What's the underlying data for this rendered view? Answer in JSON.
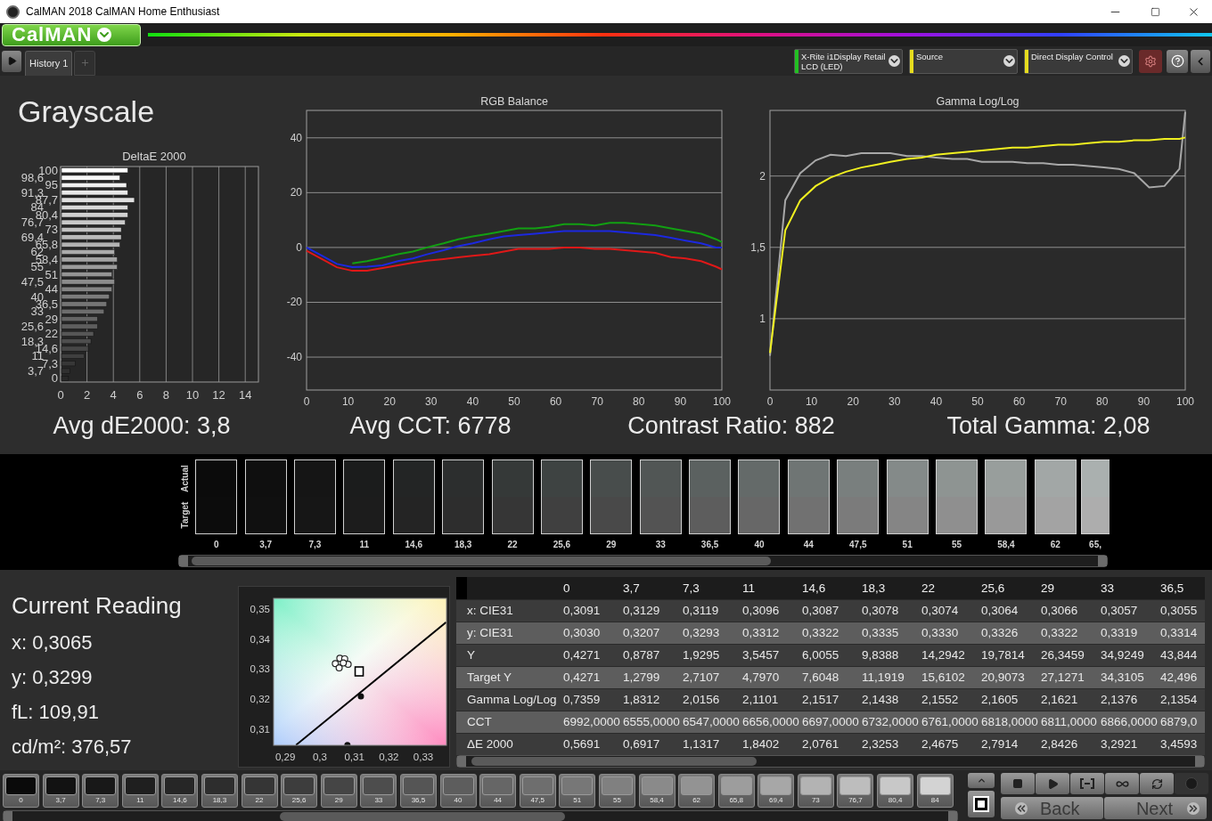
{
  "window": {
    "title": "CalMAN 2018 CalMAN Home Enthusiast"
  },
  "toolbar": {
    "logo": "CalMAN"
  },
  "tabs": [
    {
      "label": "History 1",
      "selected": true
    }
  ],
  "devices": [
    {
      "label": "X-Rite i1Display Retail",
      "sublabel": "LCD (LED)",
      "color": "#22c022"
    },
    {
      "label": "Source",
      "color": "#e6dc1e"
    },
    {
      "label": "Direct Display Control",
      "color": "#e6dc1e"
    }
  ],
  "page": {
    "title": "Grayscale",
    "delta_chart": {
      "chart_data": {
        "type": "bar",
        "orientation": "horizontal",
        "title": "DeltaE 2000",
        "grid": true,
        "categories": [
          "100",
          "98,6",
          "95",
          "91,3",
          "87,7",
          "84",
          "80,4",
          "76,7",
          "73",
          "69,4",
          "65,8",
          "62",
          "58,4",
          "55",
          "51",
          "47,5",
          "44",
          "40",
          "36,5",
          "33",
          "29",
          "25,6",
          "22",
          "18,3",
          "14,6",
          "11",
          "7,3",
          "3,7",
          "0"
        ],
        "values": [
          5.1,
          4.5,
          5.0,
          5.1,
          5.6,
          5.1,
          5.1,
          4.9,
          4.6,
          4.6,
          4.5,
          4.1,
          4.3,
          4.3,
          3.9,
          4.1,
          3.9,
          3.7,
          3.5,
          3.3,
          2.8,
          2.8,
          2.5,
          2.3,
          2.1,
          1.8,
          1.1,
          0.7,
          0.6
        ],
        "xlim": [
          0,
          15
        ],
        "xticks": [
          0,
          2,
          4,
          6,
          8,
          10,
          12,
          14
        ]
      }
    },
    "rgb_chart": {
      "chart_data": {
        "type": "line",
        "title": "RGB Balance",
        "grid": true,
        "x": [
          0,
          3.7,
          7.3,
          11,
          14.6,
          18.3,
          22,
          25.6,
          29,
          33,
          36.5,
          40,
          44,
          47.5,
          51,
          55,
          58.4,
          62,
          65.8,
          69.4,
          73,
          76.7,
          80.4,
          84,
          87.7,
          91.3,
          95,
          98.6,
          100
        ],
        "series": [
          {
            "color": "#e01818",
            "values": [
              -1.2,
              -4.2,
              -7.2,
              -8.5,
              -8.5,
              -7.5,
              -6.5,
              -5.5,
              -4.8,
              -4.2,
              -3.6,
              -3,
              -2.5,
              -1.5,
              -0.5,
              -0.5,
              -0.5,
              0,
              0,
              -0.5,
              -0.5,
              -1,
              -1.5,
              -2,
              -3.5,
              -4,
              -5,
              -7,
              -8
            ]
          },
          {
            "color": "#12a012",
            "values": [
              null,
              null,
              null,
              -5.8,
              -5,
              -3.8,
              -2.5,
              -1.5,
              0,
              1.5,
              3,
              4,
              5,
              6,
              7,
              7,
              7.5,
              8.5,
              8.5,
              8,
              9,
              9,
              8.5,
              8,
              7,
              6,
              5,
              3,
              2
            ]
          },
          {
            "color": "#1c28e0",
            "values": [
              0,
              -3,
              -6,
              -7.2,
              -7,
              -6.5,
              -5,
              -4,
              -2.5,
              -1,
              0.5,
              1.5,
              3,
              4,
              4.5,
              5,
              5.5,
              6,
              6,
              6,
              6,
              5.5,
              5,
              4.5,
              3.5,
              2.5,
              1.5,
              0,
              0
            ]
          }
        ],
        "xlim": [
          0,
          100
        ],
        "ylim": [
          -52,
          50
        ],
        "xticks": [
          0,
          10,
          20,
          30,
          40,
          50,
          60,
          70,
          80,
          90,
          100
        ],
        "yticks": [
          -40,
          -20,
          0,
          20,
          40
        ]
      }
    },
    "gamma_chart": {
      "chart_data": {
        "type": "line",
        "title": "Gamma Log/Log",
        "grid": true,
        "x": [
          0,
          3.7,
          7.3,
          11,
          14.6,
          18.3,
          22,
          25.6,
          29,
          33,
          36.5,
          40,
          44,
          47.5,
          51,
          55,
          58.4,
          62,
          65.8,
          69.4,
          73,
          76.7,
          80.4,
          84,
          87.7,
          91.3,
          95,
          98.6,
          100
        ],
        "series": [
          {
            "color": "#a8a8a8",
            "values": [
              0.74,
              1.83,
              2.02,
              2.11,
              2.15,
              2.14,
              2.16,
              2.16,
              2.16,
              2.14,
              2.14,
              2.13,
              2.12,
              2.12,
              2.1,
              2.1,
              2.1,
              2.09,
              2.09,
              2.08,
              2.08,
              2.07,
              2.06,
              2.05,
              2.02,
              1.92,
              1.93,
              2.05,
              2.45
            ]
          },
          {
            "color": "#f0f020",
            "values": [
              0.76,
              1.62,
              1.83,
              1.93,
              1.99,
              2.03,
              2.06,
              2.08,
              2.1,
              2.12,
              2.13,
              2.15,
              2.16,
              2.17,
              2.18,
              2.19,
              2.2,
              2.2,
              2.21,
              2.22,
              2.22,
              2.23,
              2.24,
              2.24,
              2.25,
              2.25,
              2.26,
              2.26,
              2.27
            ]
          }
        ],
        "xlim": [
          0,
          100
        ],
        "ylim": [
          0.5,
          2.46
        ],
        "xticks": [
          0,
          10,
          20,
          30,
          40,
          50,
          60,
          70,
          80,
          90,
          100
        ],
        "yticks": [
          {
            "value": 1,
            "label": "1"
          },
          {
            "value": 1.5,
            "label": "1,5"
          },
          {
            "value": 2,
            "label": "2"
          }
        ]
      }
    },
    "stats": [
      "Avg dE2000: 3,8",
      "Avg CCT: 6778",
      "Contrast Ratio: 882",
      "Total Gamma: 2,08"
    ]
  },
  "swatches": {
    "actual_label": "Actual",
    "target_label": "Target",
    "items": [
      {
        "label": "0",
        "actual": {
          "color": "#0b0b0b"
        },
        "target": {
          "color": "#0c0c0c"
        }
      },
      {
        "label": "3,7",
        "actual": {
          "color": "#0f0f0f"
        },
        "target": {
          "color": "#101010"
        }
      },
      {
        "label": "7,3",
        "actual": {
          "color": "#151515"
        },
        "target": {
          "color": "#161616"
        }
      },
      {
        "label": "11",
        "actual": {
          "color": "#1b1c1c"
        },
        "target": {
          "color": "#1c1c1c"
        }
      },
      {
        "label": "14,6",
        "actual": {
          "color": "#232525"
        },
        "target": {
          "color": "#242424"
        }
      },
      {
        "label": "18,3",
        "actual": {
          "color": "#2c2e2e"
        },
        "target": {
          "color": "#2d2d2d"
        }
      },
      {
        "label": "22",
        "actual": {
          "color": "#353938"
        },
        "target": {
          "color": "#363636"
        }
      },
      {
        "label": "25,6",
        "actual": {
          "color": "#3e4342"
        },
        "target": {
          "color": "#404040"
        }
      },
      {
        "label": "29",
        "actual": {
          "color": "#484d4c"
        },
        "target": {
          "color": "#494949"
        }
      },
      {
        "label": "33",
        "actual": {
          "color": "#515655"
        },
        "target": {
          "color": "#535353"
        }
      },
      {
        "label": "36,5",
        "actual": {
          "color": "#5b6160"
        },
        "target": {
          "color": "#5d5d5d"
        }
      },
      {
        "label": "40",
        "actual": {
          "color": "#646a69"
        },
        "target": {
          "color": "#676767"
        }
      },
      {
        "label": "44",
        "actual": {
          "color": "#6f7574"
        },
        "target": {
          "color": "#717171"
        }
      },
      {
        "label": "47,5",
        "actual": {
          "color": "#797f7e"
        },
        "target": {
          "color": "#7b7b7b"
        }
      },
      {
        "label": "51",
        "actual": {
          "color": "#848a89"
        },
        "target": {
          "color": "#858585"
        }
      },
      {
        "label": "55",
        "actual": {
          "color": "#8e9492"
        },
        "target": {
          "color": "#8f8f8f"
        }
      },
      {
        "label": "58,4",
        "actual": {
          "color": "#989e9c"
        },
        "target": {
          "color": "#999999"
        }
      },
      {
        "label": "62",
        "actual": {
          "color": "#a2a7a6"
        },
        "target": {
          "color": "#a3a3a3"
        }
      },
      {
        "label": "65,",
        "actual": {
          "color": "#aab0af"
        },
        "target": {
          "color": "#adadad"
        }
      }
    ]
  },
  "current_reading": {
    "title": "Current Reading",
    "values": [
      "x: 0,3065",
      "y: 0,3299",
      "fL: 109,91",
      "cd/m²: 376,57"
    ]
  },
  "chromaticity": {
    "chart_data": {
      "type": "scatter",
      "x": [
        0.3045,
        0.3058,
        0.3072,
        0.3082,
        0.3056,
        0.3068,
        0.3114,
        0.3119,
        0.308,
        0.2931,
        0.3366
      ],
      "series": [
        {
          "type": "scatter",
          "color": "#ffffff",
          "values": [
            0.3318,
            0.3336,
            0.3334,
            0.3316,
            0.3304,
            0.332,
            null,
            null,
            null,
            null,
            null
          ]
        },
        {
          "type": "scatter",
          "color": "#000000",
          "values": [
            null,
            null,
            null,
            null,
            null,
            null,
            0.3292,
            null,
            null,
            null,
            null
          ]
        },
        {
          "type": "scatter",
          "color": "#111111",
          "values": [
            null,
            null,
            null,
            null,
            null,
            null,
            null,
            0.3209,
            0.3046,
            null,
            null
          ]
        },
        {
          "type": "line",
          "color": "#000000",
          "values": [
            null,
            null,
            null,
            null,
            null,
            null,
            null,
            null,
            null,
            0.3046,
            0.3456
          ]
        }
      ],
      "xlim": [
        0.2866,
        0.3367
      ],
      "ylim": [
        0.3045,
        0.3536
      ],
      "xticks": [
        {
          "value": 0.29,
          "label": "0,29"
        },
        {
          "value": 0.3,
          "label": "0,3"
        },
        {
          "value": 0.31,
          "label": "0,31"
        },
        {
          "value": 0.32,
          "label": "0,32"
        },
        {
          "value": 0.33,
          "label": "0,33"
        }
      ],
      "yticks": [
        {
          "value": 0.31,
          "label": "0,31"
        },
        {
          "value": 0.32,
          "label": "0,32"
        },
        {
          "value": 0.33,
          "label": "0,33"
        },
        {
          "value": 0.34,
          "label": "0,34"
        },
        {
          "value": 0.35,
          "label": "0,35"
        }
      ]
    }
  },
  "table": {
    "columns": [
      "0",
      "3,7",
      "7,3",
      "11",
      "14,6",
      "18,3",
      "22",
      "25,6",
      "29",
      "33",
      "36,5"
    ],
    "rows": [
      {
        "label": "x: CIE31",
        "cells": [
          "0,3091",
          "0,3129",
          "0,3119",
          "0,3096",
          "0,3087",
          "0,3078",
          "0,3074",
          "0,3064",
          "0,3066",
          "0,3057",
          "0,3055"
        ]
      },
      {
        "label": "y: CIE31",
        "cells": [
          "0,3030",
          "0,3207",
          "0,3293",
          "0,3312",
          "0,3322",
          "0,3335",
          "0,3330",
          "0,3326",
          "0,3322",
          "0,3319",
          "0,3314"
        ]
      },
      {
        "label": "Y",
        "cells": [
          "0,4271",
          "0,8787",
          "1,9295",
          "3,5457",
          "6,0055",
          "9,8388",
          "14,2942",
          "19,7814",
          "26,3459",
          "34,9249",
          "43,844"
        ]
      },
      {
        "label": "Target Y",
        "cells": [
          "0,4271",
          "1,2799",
          "2,7107",
          "4,7970",
          "7,6048",
          "11,1919",
          "15,6102",
          "20,9073",
          "27,1271",
          "34,3105",
          "42,496"
        ]
      },
      {
        "label": "Gamma Log/Log",
        "cells": [
          "0,7359",
          "1,8312",
          "2,0156",
          "2,1101",
          "2,1517",
          "2,1438",
          "2,1552",
          "2,1605",
          "2,1621",
          "2,1376",
          "2,1354"
        ]
      },
      {
        "label": "CCT",
        "cells": [
          "6992,0000",
          "6555,0000",
          "6547,0000",
          "6656,0000",
          "6697,0000",
          "6732,0000",
          "6761,0000",
          "6818,0000",
          "6811,0000",
          "6866,0000",
          "6879,0"
        ]
      },
      {
        "label": "ΔE 2000",
        "cells": [
          "0,5691",
          "0,6917",
          "1,1317",
          "1,8402",
          "2,0761",
          "2,3253",
          "2,4675",
          "2,7914",
          "2,8426",
          "3,2921",
          "3,4593"
        ]
      }
    ]
  },
  "patches": [
    {
      "label": "0",
      "color": "#0a0a0a"
    },
    {
      "label": "3,7",
      "color": "#121212"
    },
    {
      "label": "7,3",
      "color": "#181818"
    },
    {
      "label": "11",
      "color": "#1f1f1f"
    },
    {
      "label": "14,6",
      "color": "#262626"
    },
    {
      "label": "18,3",
      "color": "#2d2d2d"
    },
    {
      "label": "22",
      "color": "#353535"
    },
    {
      "label": "25,6",
      "color": "#3d3d3d"
    },
    {
      "label": "29",
      "color": "#454545"
    },
    {
      "label": "33",
      "color": "#4d4d4d"
    },
    {
      "label": "36,5",
      "color": "#555555"
    },
    {
      "label": "40",
      "color": "#5d5d5d"
    },
    {
      "label": "44",
      "color": "#666666"
    },
    {
      "label": "47,5",
      "color": "#6e6e6e"
    },
    {
      "label": "51",
      "color": "#777777"
    },
    {
      "label": "55",
      "color": "#808080"
    },
    {
      "label": "58,4",
      "color": "#8a8a8a"
    },
    {
      "label": "62",
      "color": "#939393"
    },
    {
      "label": "65,8",
      "color": "#9d9d9d"
    },
    {
      "label": "69,4",
      "color": "#a7a7a7"
    },
    {
      "label": "73",
      "color": "#b3b3b3"
    },
    {
      "label": "76,7",
      "color": "#bdbdbd"
    },
    {
      "label": "80,4",
      "color": "#c8c8c8"
    },
    {
      "label": "84",
      "color": "#d3d3d3"
    }
  ],
  "controls": {
    "back": "Back",
    "next": "Next"
  }
}
